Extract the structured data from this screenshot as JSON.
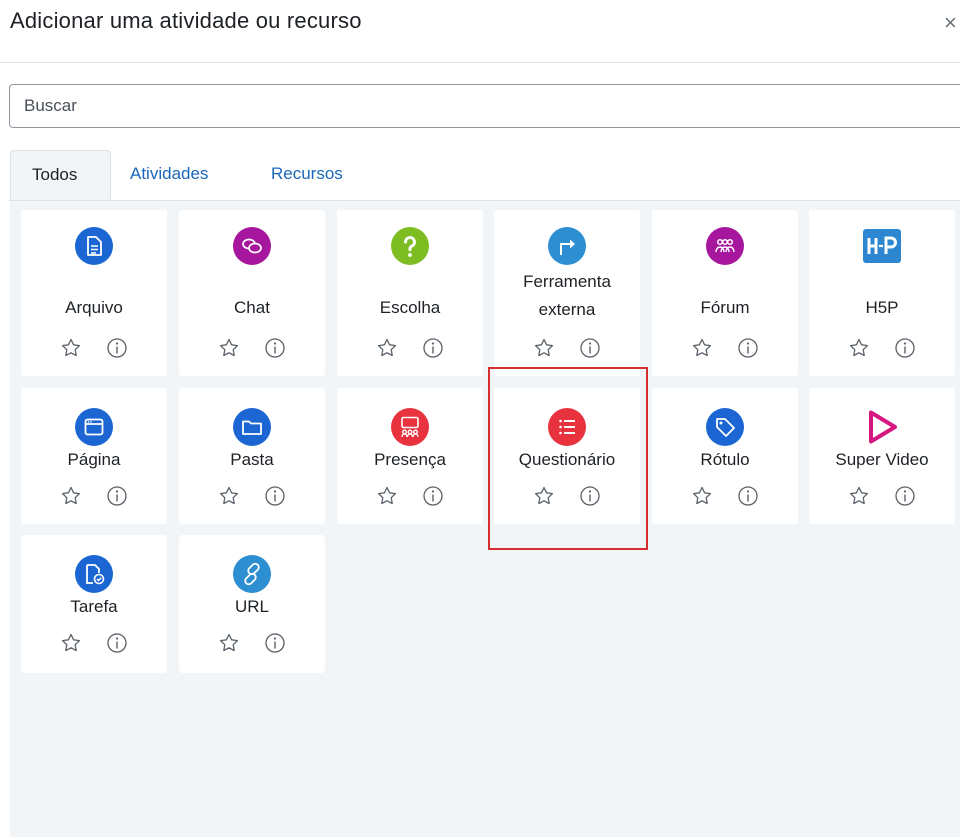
{
  "dialog": {
    "title": "Adicionar uma atividade ou recurso",
    "close_symbol": "×"
  },
  "search": {
    "placeholder": "Buscar",
    "value": ""
  },
  "tabs": [
    {
      "label": "Todos",
      "active": true
    },
    {
      "label": "Atividades",
      "active": false
    },
    {
      "label": "Recursos",
      "active": false
    }
  ],
  "modules": [
    {
      "name": "Arquivo",
      "icon": "file-icon",
      "color": "#1b66d2"
    },
    {
      "name": "Chat",
      "icon": "chat-icon",
      "color": "#a6179d"
    },
    {
      "name": "Escolha",
      "icon": "question-icon",
      "color": "#7dbd21"
    },
    {
      "name": "Ferramenta externa",
      "icon": "external-tool-icon",
      "color": "#2d8ed1"
    },
    {
      "name": "Fórum",
      "icon": "forum-icon",
      "color": "#a6179d"
    },
    {
      "name": "H5P",
      "icon": "h5p-icon",
      "color": "#2d86d0"
    },
    {
      "name": "Página",
      "icon": "page-icon",
      "color": "#1b66d2"
    },
    {
      "name": "Pasta",
      "icon": "folder-icon",
      "color": "#1b66d2"
    },
    {
      "name": "Presença",
      "icon": "attendance-icon",
      "color": "#e8333f"
    },
    {
      "name": "Questionário",
      "icon": "quiz-icon",
      "color": "#e8333f"
    },
    {
      "name": "Rótulo",
      "icon": "label-icon",
      "color": "#1b66d2"
    },
    {
      "name": "Super Video",
      "icon": "play-triangle-icon",
      "color": "#d5177f"
    },
    {
      "name": "Tarefa",
      "icon": "assignment-icon",
      "color": "#1b66d2"
    },
    {
      "name": "URL",
      "icon": "link-icon",
      "color": "#2d8ed1"
    }
  ],
  "highlighted_module": "Questionário"
}
